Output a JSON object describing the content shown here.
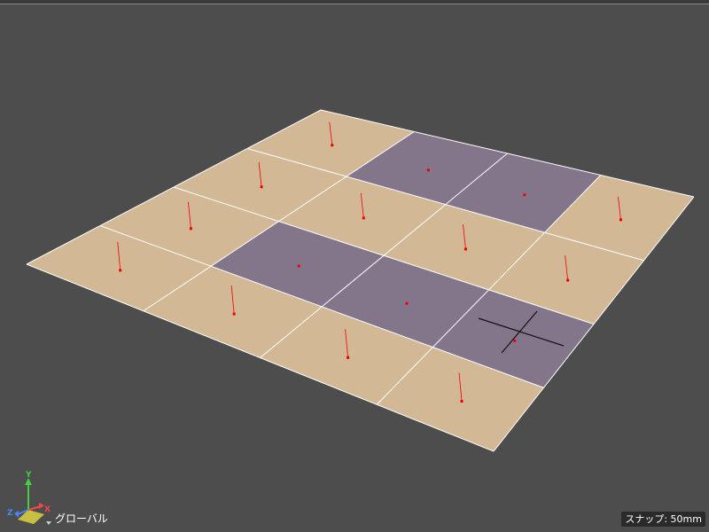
{
  "viewport": {
    "coordinate_system_label": "グローバル",
    "snap_label": "スナップ: 50mm"
  },
  "gizmo": {
    "axis_x": "X",
    "axis_y": "Y",
    "axis_z": "Z",
    "color_x": "#ff4444",
    "color_y": "#44cc44",
    "color_z": "#4488ff",
    "plane_color": "#c8c040"
  },
  "grid": {
    "rows": 4,
    "cols": 4,
    "tile_color": "#d3b895",
    "selected_color": "#83768a",
    "line_color": "#ffffff",
    "marker_color": "#ee0000",
    "selected_tiles": [
      [
        0,
        1
      ],
      [
        0,
        2
      ],
      [
        2,
        1
      ],
      [
        2,
        2
      ],
      [
        2,
        3
      ]
    ]
  },
  "cursor_icon": "crosshair-cursor"
}
